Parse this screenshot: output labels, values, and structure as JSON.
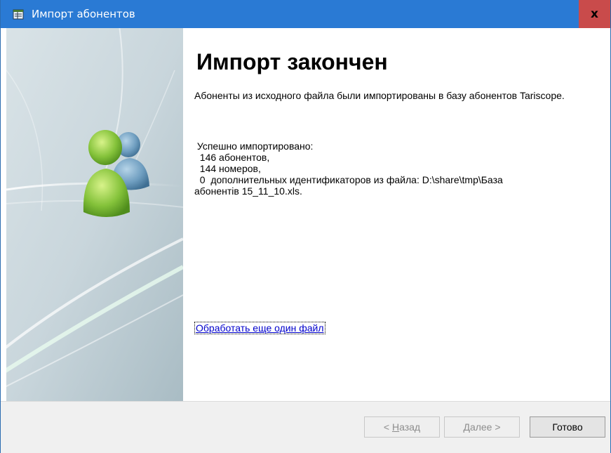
{
  "window": {
    "title": "Импорт абонентов",
    "close_label": "x"
  },
  "colors": {
    "titlebar": "#2a7ad4",
    "close_button": "#c94b4b",
    "link": "#0000cc"
  },
  "main": {
    "heading": "Импорт закончен",
    "description": "Абоненты из исходного файла были импортированы в базу абонентов Tariscope.",
    "results": [
      " Успешно импортировано:",
      "  146 абонентов,",
      "  144 номеров,",
      "  0  дополнительных идентификаторов из файла: D:\\share\\tmp\\База",
      "абонентів 15_11_10.xls."
    ],
    "link_text": "Обработать еще один файл"
  },
  "footer": {
    "back": {
      "prefix": "< ",
      "underlined": "Н",
      "rest": "азад"
    },
    "next": {
      "underlined": "Д",
      "rest": "алее >"
    },
    "finish_label": "Готово"
  }
}
